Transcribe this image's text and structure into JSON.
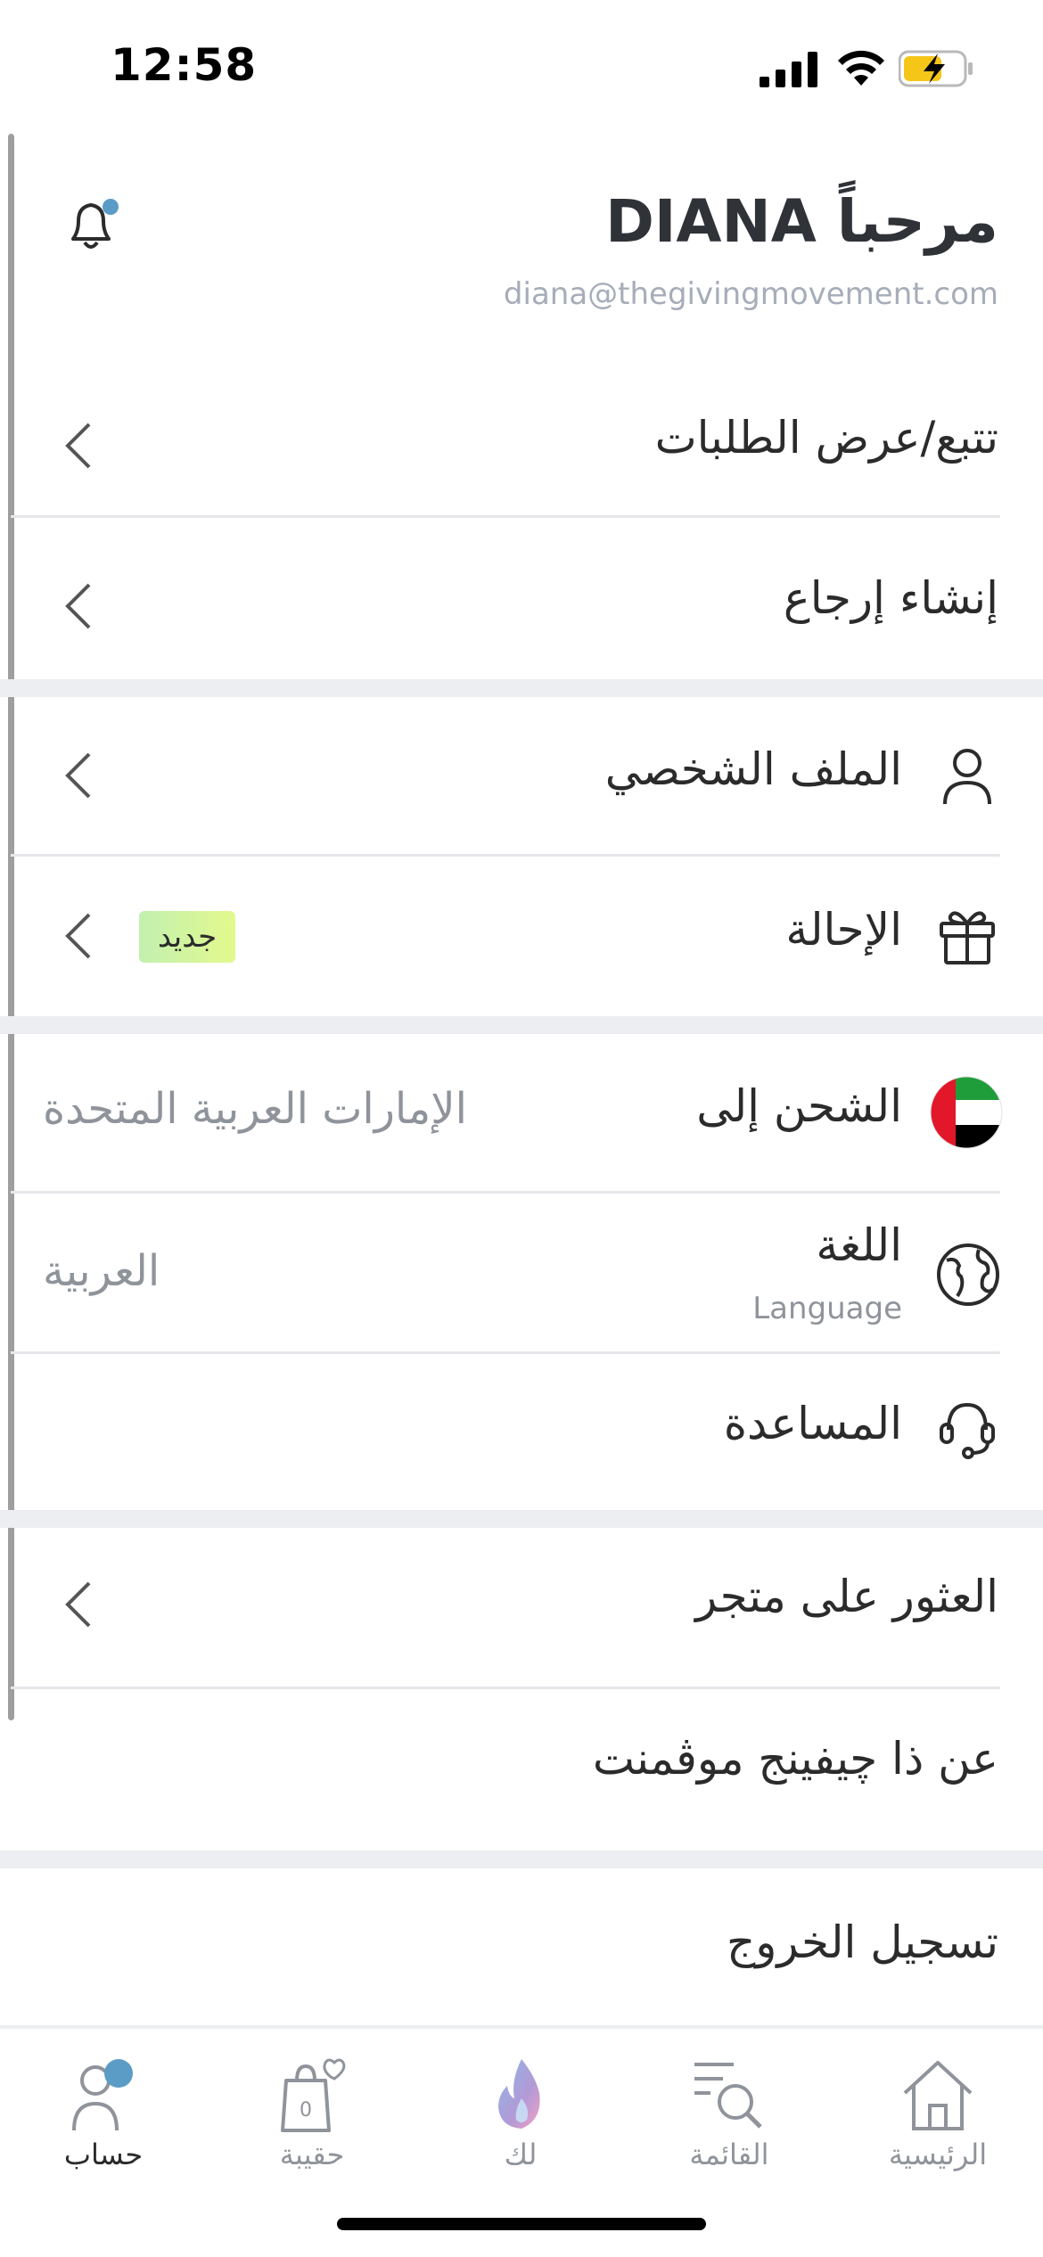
{
  "status": {
    "time": "12:58"
  },
  "header": {
    "greeting": "مرحباً DIANA",
    "email": "diana@thegivingmovement.com"
  },
  "menu": {
    "track_orders": "تتبع/عرض الطلبات",
    "create_return": "إنشاء إرجاع",
    "profile": "الملف الشخصي",
    "referral": "الإحالة",
    "referral_badge": "جديد",
    "ship_to": "الشحن إلى",
    "ship_to_value": "الإمارات العربية المتحدة",
    "language": "اللغة",
    "language_sub": "Language",
    "language_value": "العربية",
    "help": "المساعدة",
    "find_store": "العثور على متجر",
    "about": "عن ذا چيفينج موڤمنت",
    "logout": "تسجيل الخروج"
  },
  "tabs": {
    "account": "حساب",
    "bag": "حقيبة",
    "bag_count": "0",
    "for_you": "لك",
    "menu": "القائمة",
    "home": "الرئيسية"
  },
  "colors": {
    "accent_dot": "#5b9cc6",
    "badge_start": "#c2f0b0",
    "badge_end": "#e3f98d",
    "separator": "#eceef1",
    "muted_text": "#8f949b"
  },
  "icons": [
    "bell-icon",
    "chevron-left-icon",
    "user-icon",
    "gift-icon",
    "uae-flag-icon",
    "globe-icon",
    "headset-icon",
    "home-icon",
    "search-list-icon",
    "flame-icon",
    "shopping-bag-icon",
    "account-icon"
  ]
}
